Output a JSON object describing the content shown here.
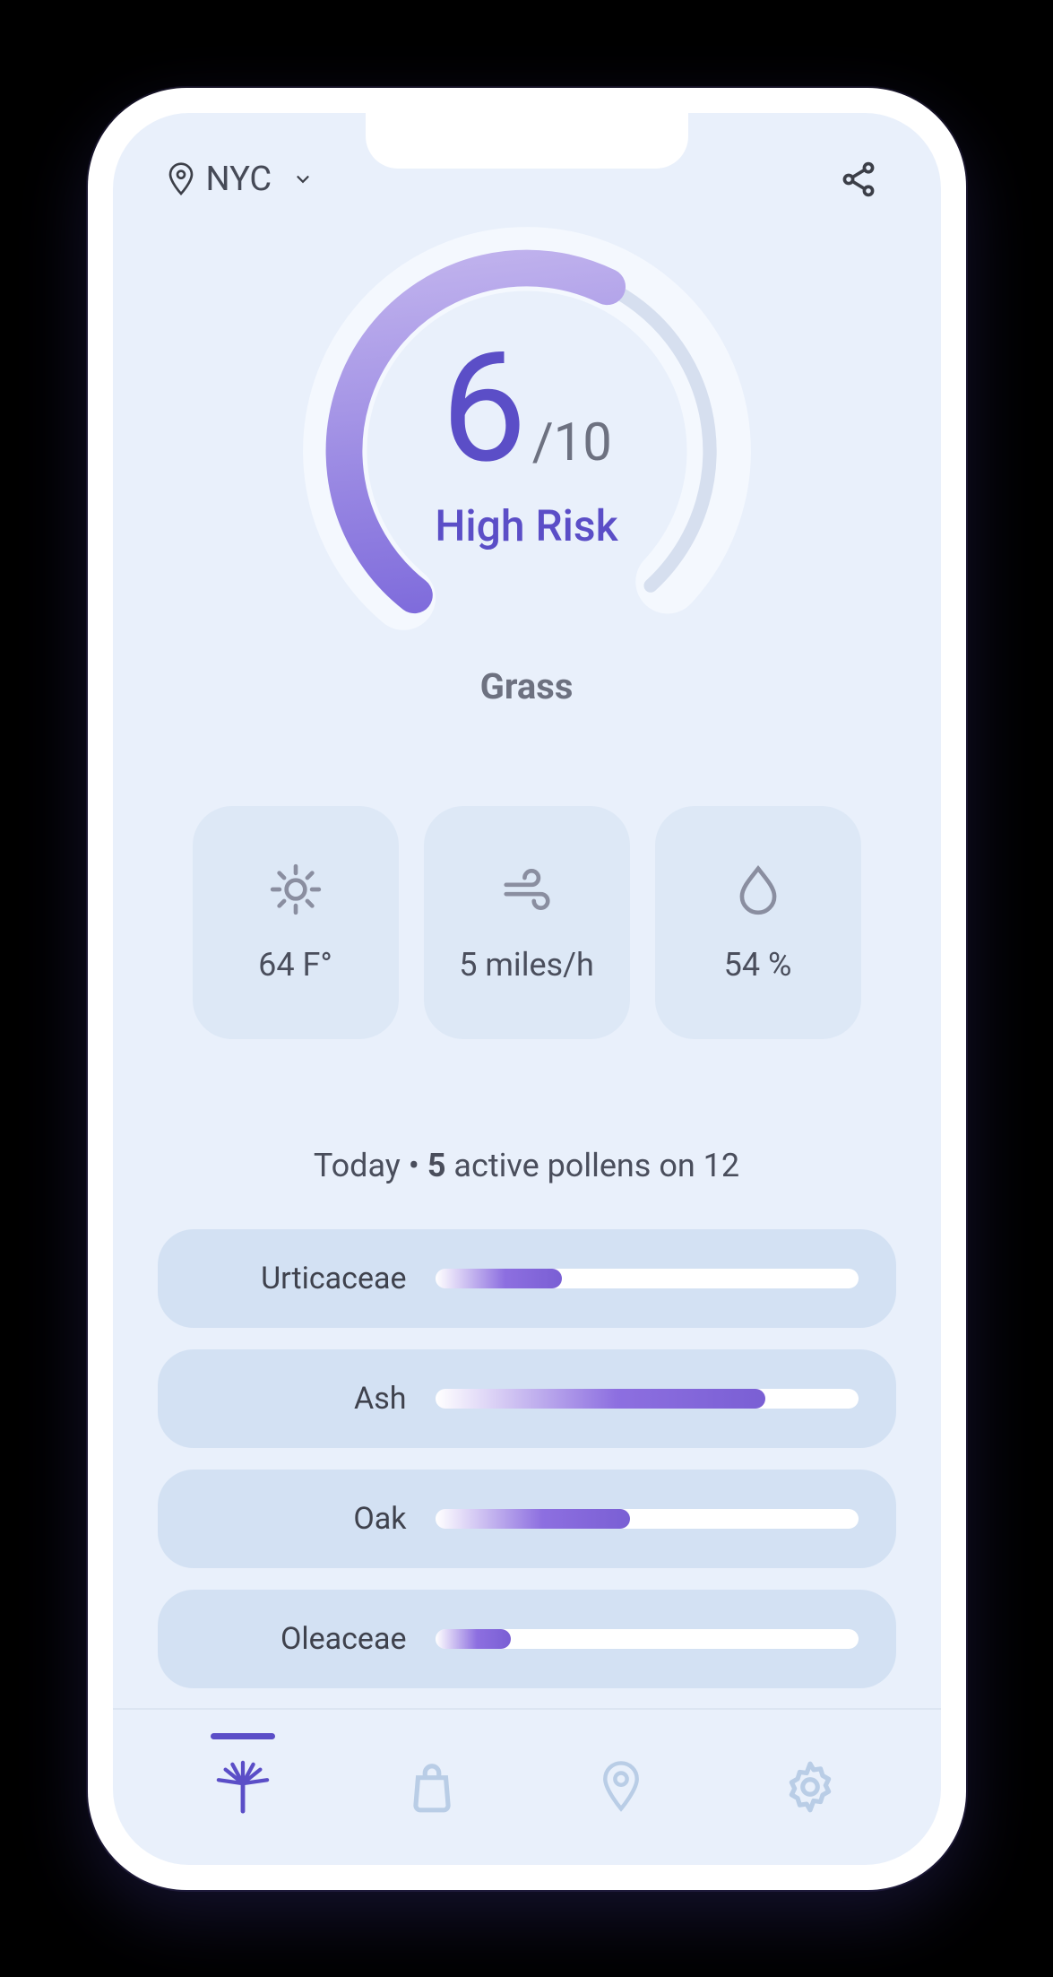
{
  "header": {
    "location": "NYC"
  },
  "gauge": {
    "score": "6",
    "max": "/10",
    "risk_label": "High Risk",
    "category": "Grass",
    "fraction": 0.6
  },
  "weather": {
    "temp": "64 F°",
    "wind": "5 miles/h",
    "humidity": "54 %"
  },
  "summary": {
    "prefix": "Today • ",
    "count": "5",
    "suffix": " active pollens on 12"
  },
  "pollens": [
    {
      "name": "Urticaceae",
      "level": 0.3
    },
    {
      "name": "Ash",
      "level": 0.78
    },
    {
      "name": "Oak",
      "level": 0.46
    },
    {
      "name": "Oleaceae",
      "level": 0.18
    }
  ],
  "tabs": {
    "active_index": 0,
    "items": [
      "pollen",
      "shop",
      "location",
      "settings"
    ]
  },
  "colors": {
    "accent": "#5b4ec7",
    "card": "#dde8f6"
  }
}
